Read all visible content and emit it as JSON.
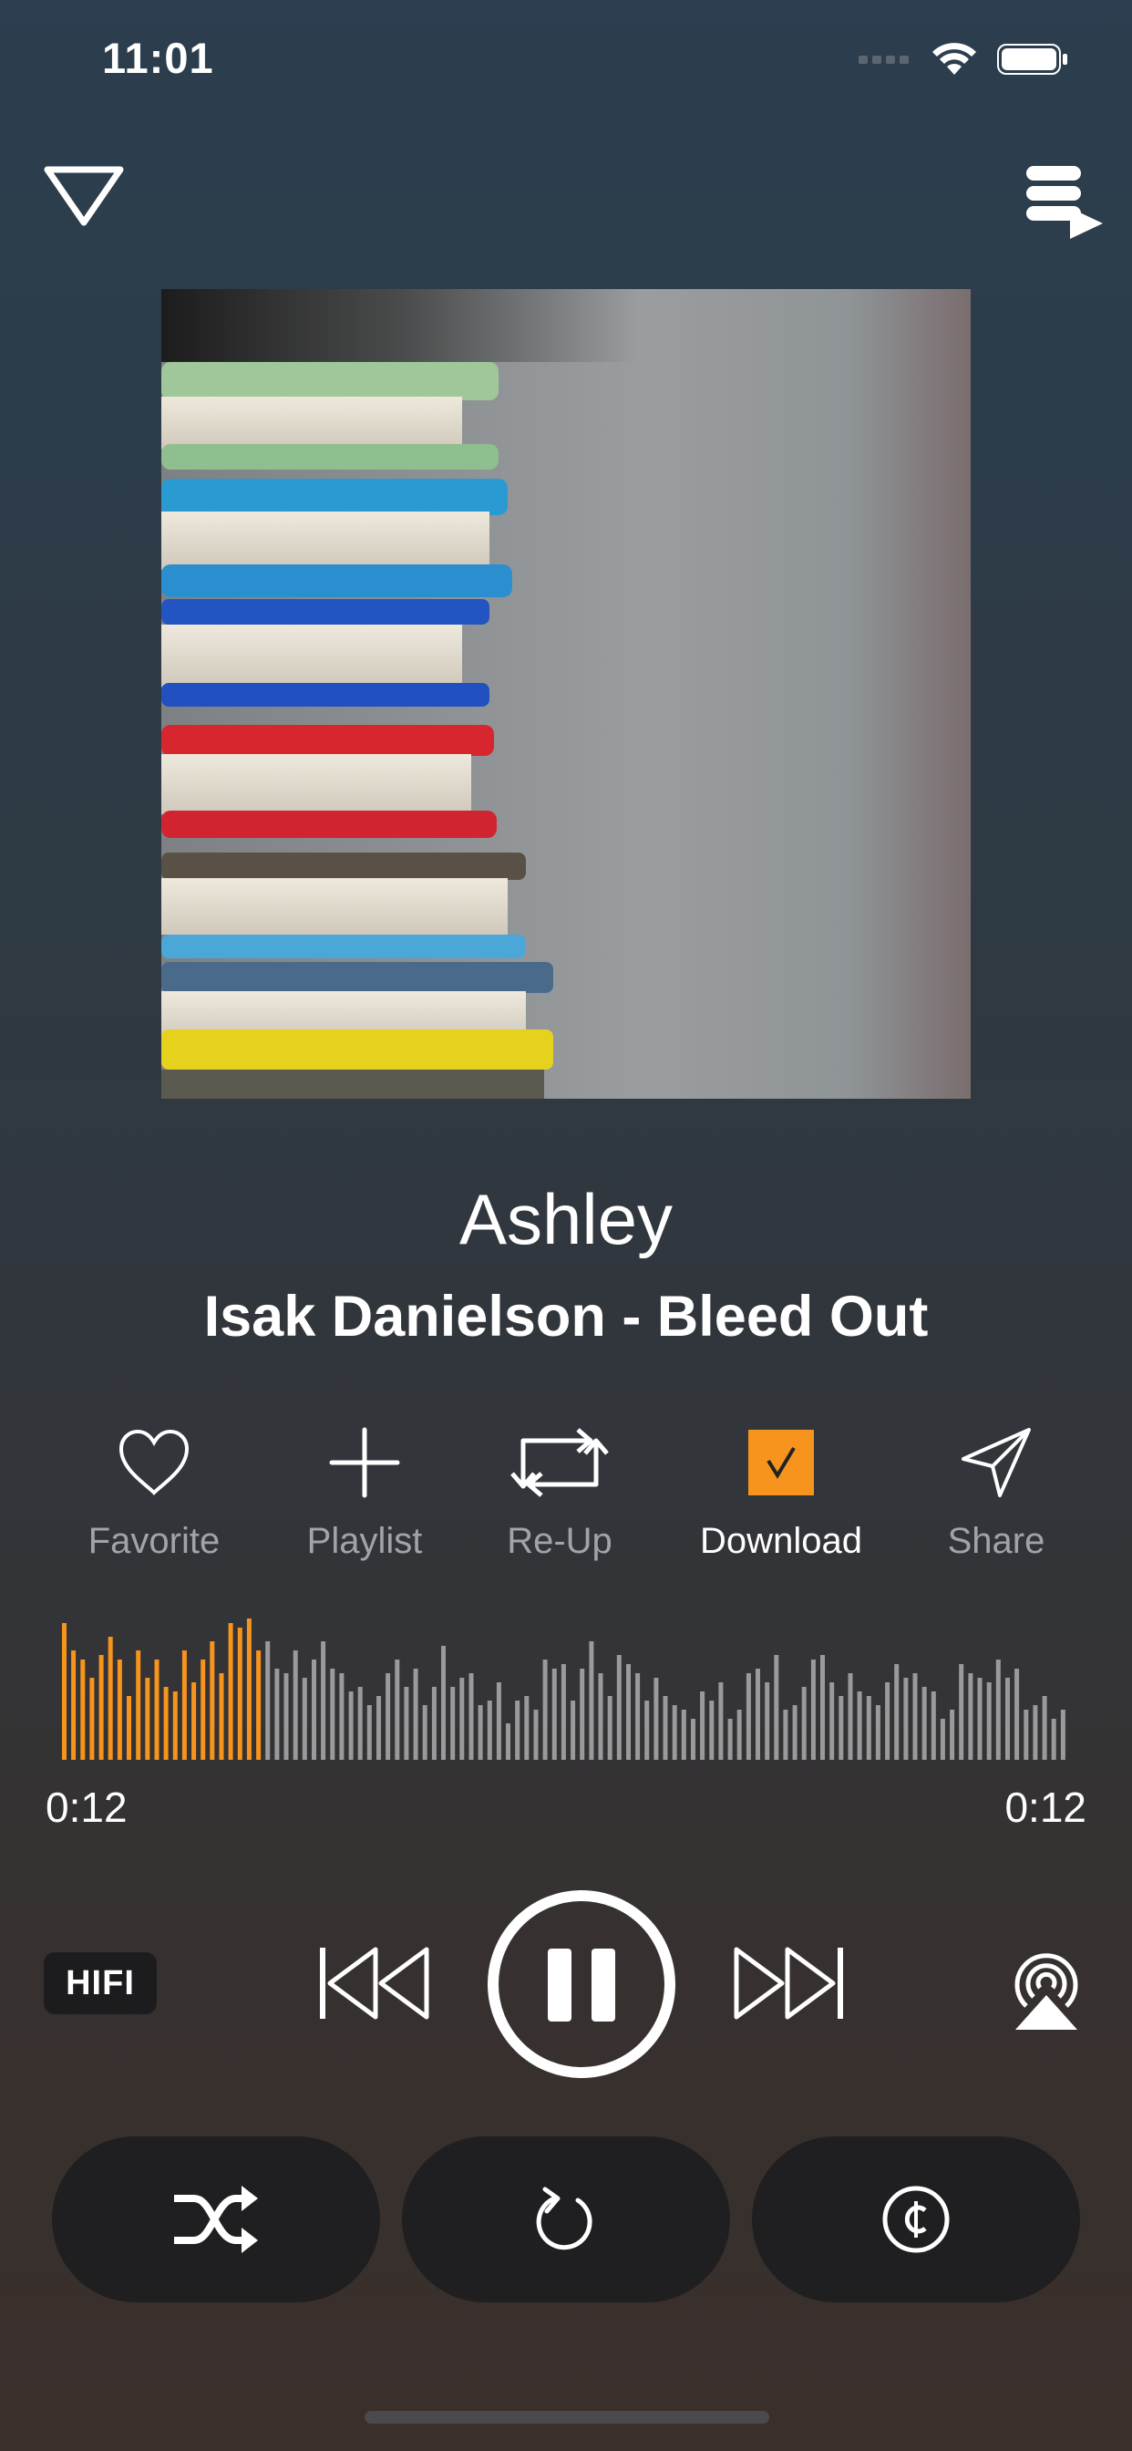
{
  "status_bar": {
    "time": "11:01"
  },
  "artwork": {
    "description_icon": "album-art"
  },
  "track": {
    "title": "Ashley",
    "subtitle": "Isak Danielson - Bleed Out"
  },
  "actions": [
    {
      "label": "Favorite",
      "icon": "heart-icon",
      "active": false
    },
    {
      "label": "Playlist",
      "icon": "plus-icon",
      "active": false
    },
    {
      "label": "Re-Up",
      "icon": "repost-icon",
      "active": false
    },
    {
      "label": "Download",
      "icon": "checkbox-icon",
      "active": true
    },
    {
      "label": "Share",
      "icon": "send-icon",
      "active": false
    }
  ],
  "progress": {
    "elapsed": "0:12",
    "remaining": "0:12",
    "played_fraction": 0.2
  },
  "transport": {
    "quality_badge": "HIFI"
  },
  "colors": {
    "accent": "#f7941d",
    "waveform_unplayed": "#9a9a9c",
    "label_inactive": "#a0a4a8",
    "pill_bg": "#1f1f21"
  }
}
